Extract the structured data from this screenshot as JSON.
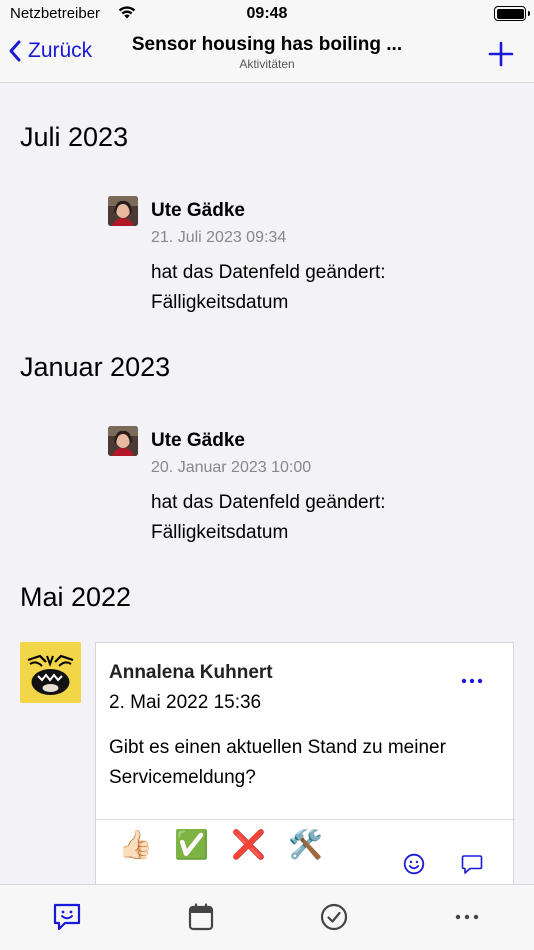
{
  "status_bar": {
    "carrier": "Netzbetreiber",
    "time": "09:48"
  },
  "nav": {
    "back_label": "Zurück",
    "title": "Sensor housing has boiling ...",
    "subtitle": "Aktivitäten"
  },
  "timeline": {
    "months": [
      "Juli 2023",
      "Januar 2023",
      "Mai 2022"
    ],
    "entries": [
      {
        "name": "Ute Gädke",
        "date": "21. Juli 2023 09:34",
        "text": "hat das Datenfeld geändert: Fälligkeitsdatum"
      },
      {
        "name": "Ute Gädke",
        "date": "20. Januar 2023 10:00",
        "text": "hat das Datenfeld geändert: Fälligkeitsdatum"
      }
    ],
    "comment": {
      "name": "Annalena Kuhnert",
      "date": "2. Mai 2022 15:36",
      "text": "Gibt es einen aktuellen Stand zu meiner Servicemeldung?",
      "reactions": [
        "👍🏻",
        "✅",
        "❌",
        "🛠️"
      ]
    }
  },
  "colors": {
    "accent": "#1a1ad6",
    "background": "#f2f2f7",
    "avatar_yellow": "#f3d548"
  },
  "tab_bar": {
    "icons": [
      "feedback-icon",
      "calendar-icon",
      "checkmark-circle-icon",
      "more-icon"
    ]
  }
}
